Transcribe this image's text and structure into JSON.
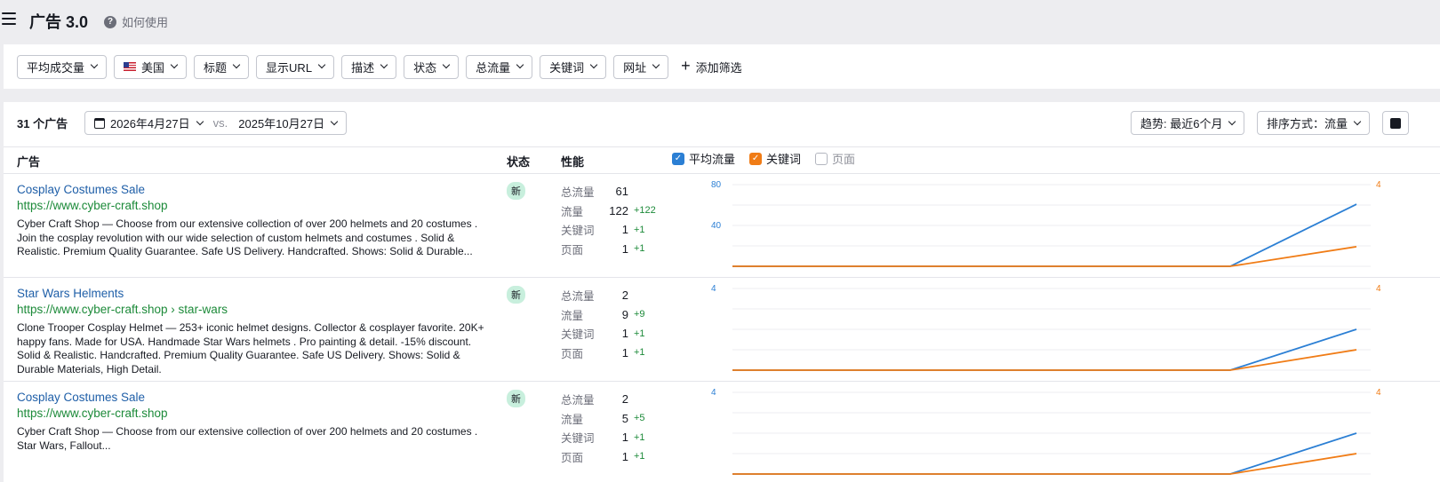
{
  "header": {
    "title": "广告 3.0",
    "help_label": "如何使用"
  },
  "filters": {
    "items": [
      "平均成交量",
      "美国",
      "标题",
      "显示URL",
      "描述",
      "状态",
      "总流量",
      "关键词",
      "网址"
    ],
    "add_filter_label": "添加筛选"
  },
  "toolbar": {
    "ads_count": "31 个广告",
    "date_current": "2026年4月27日",
    "vs_label": "vs.",
    "date_compare": "2025年10月27日",
    "trend_label": "趋势: 最近6个月",
    "sort_label": "排序方式：流量"
  },
  "columns": {
    "ad": "广告",
    "status": "状态",
    "performance": "性能"
  },
  "legend": {
    "avg_traffic": "平均流量",
    "keywords": "关键词",
    "pages": "页面",
    "avg_traffic_color": "#2b7fd4",
    "keywords_color": "#f07c16"
  },
  "metric_labels": {
    "total_traffic": "总流量",
    "traffic": "流量",
    "keywords": "关键词",
    "pages": "页面"
  },
  "ads": [
    {
      "title": "Cosplay Costumes Sale",
      "url": "https://www.cyber-craft.shop",
      "description": "Cyber Craft Shop — Choose from our extensive collection of over 200 helmets and 20 costumes . Join the cosplay revolution with our wide selection of custom helmets and costumes . Solid & Realistic. Premium Quality Guarantee. Safe US Delivery. Handcrafted. Shows: Solid & Durable...",
      "status": "新",
      "total_traffic": "61",
      "traffic": "122",
      "traffic_delta": "+122",
      "keywords": "1",
      "keywords_delta": "+1",
      "pages": "1",
      "pages_delta": "+1",
      "chart": {
        "left_ticks": [
          "80",
          "40"
        ],
        "right_ticks": [
          "4"
        ],
        "blue_end_fraction": 0.76,
        "orange_end_fraction": 0.24
      }
    },
    {
      "title": "Star Wars Helments",
      "url": "https://www.cyber-craft.shop › star-wars",
      "description": "Clone Trooper Cosplay Helmet — 253+ iconic helmet designs. Collector & cosplayer favorite. 20K+ happy fans. Made for USA. Handmade Star Wars helmets . Pro painting & detail. -15% discount. Solid & Realistic. Handcrafted. Premium Quality Guarantee. Safe US Delivery. Shows: Solid & Durable Materials, High Detail.",
      "status": "新",
      "total_traffic": "2",
      "traffic": "9",
      "traffic_delta": "+9",
      "keywords": "1",
      "keywords_delta": "+1",
      "pages": "1",
      "pages_delta": "+1",
      "chart": {
        "left_ticks": [
          "4"
        ],
        "right_ticks": [
          "4"
        ],
        "blue_end_fraction": 0.5,
        "orange_end_fraction": 0.25
      }
    },
    {
      "title": "Cosplay Costumes Sale",
      "url": "https://www.cyber-craft.shop",
      "description": "Cyber Craft Shop — Choose from our extensive collection of over 200 helmets and 20 costumes . Star Wars, Fallout...",
      "status": "新",
      "total_traffic": "2",
      "traffic": "5",
      "traffic_delta": "+5",
      "keywords": "1",
      "keywords_delta": "+1",
      "pages": "1",
      "pages_delta": "+1",
      "chart": {
        "left_ticks": [
          "4"
        ],
        "right_ticks": [
          "4"
        ],
        "blue_end_fraction": 0.5,
        "orange_end_fraction": 0.25
      }
    }
  ]
}
